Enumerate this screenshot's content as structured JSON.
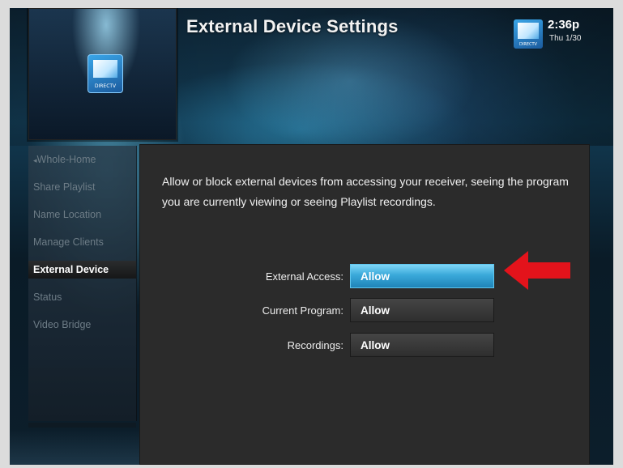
{
  "header": {
    "title": "External Device Settings",
    "time": "2:36p",
    "date": "Thu 1/30",
    "logo_text": "DIRECTV"
  },
  "preview": {
    "logo_text": "DIRECTV"
  },
  "sidebar": {
    "items": [
      {
        "label": "Whole-Home",
        "active": false
      },
      {
        "label": "Share Playlist",
        "active": false
      },
      {
        "label": "Name Location",
        "active": false
      },
      {
        "label": "Manage Clients",
        "active": false
      },
      {
        "label": "External Device",
        "active": true
      },
      {
        "label": "Status",
        "active": false
      },
      {
        "label": "Video Bridge",
        "active": false
      }
    ]
  },
  "content": {
    "description": "Allow or block external devices from accessing your receiver, seeing the program you are currently viewing or seeing Playlist recordings.",
    "settings": [
      {
        "label": "External Access:",
        "value": "Allow",
        "focused": true
      },
      {
        "label": "Current Program:",
        "value": "Allow",
        "focused": false
      },
      {
        "label": "Recordings:",
        "value": "Allow",
        "focused": false
      }
    ]
  },
  "colors": {
    "focus_accent": "#3aa9da",
    "pointer_arrow": "#e3131b"
  },
  "icons": {
    "pointer": "red-arrow-left-icon",
    "back": "chevron-left-icon"
  }
}
